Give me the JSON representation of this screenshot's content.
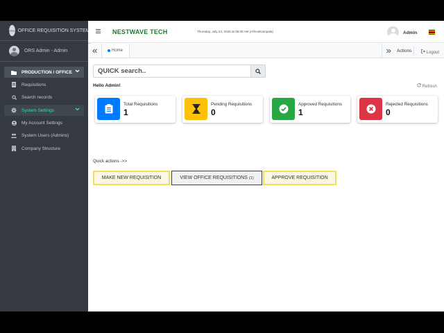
{
  "sidebar": {
    "brand_logo_text": "ORS",
    "brand_text": "OFFICE REQUISITION SYSTEM",
    "user_name": "ORS Admin - Admin",
    "items": [
      {
        "label": "PRODUCTION / OFFICE",
        "icon": "folder-icon",
        "type": "header"
      },
      {
        "label": "Requisitions",
        "icon": "document-icon",
        "type": "sub"
      },
      {
        "label": "Search records",
        "icon": "search-icon",
        "type": "sub"
      },
      {
        "label": "System Settings",
        "icon": "gear-icon",
        "type": "active"
      },
      {
        "label": "My Account Settings",
        "icon": "user-icon",
        "type": "sub"
      },
      {
        "label": "System Users (Admins)",
        "icon": "users-icon",
        "type": "sub"
      },
      {
        "label": "Company Structure",
        "icon": "building-icon",
        "type": "sub"
      }
    ]
  },
  "topbar": {
    "company": "NESTWAVE TECH",
    "datetime": "Thursday, July 23, 2026 at 06:09 AM (Africa/Kampala)",
    "user": "Admin",
    "flag_colors": [
      "#000000",
      "#fcdc04",
      "#d90000",
      "#000000",
      "#fcdc04",
      "#d90000"
    ]
  },
  "tabbar": {
    "home_label": "Home",
    "actions_label": "Actions",
    "logout_label": "Logout"
  },
  "main": {
    "search_placeholder": "QUICK search..",
    "hello": "Hello Admin!",
    "refresh_label": "Refresh",
    "stats": [
      {
        "label": "Total Requisitions",
        "value": "1",
        "color": "#007bff",
        "icon": "clipboard-icon"
      },
      {
        "label": "Pending Requisitions",
        "value": "0",
        "color": "#ffc107",
        "icon": "hourglass-icon"
      },
      {
        "label": "Approved Requisitions",
        "value": "1",
        "color": "#28a745",
        "icon": "check-circle-icon"
      },
      {
        "label": "Rejected Requisitions",
        "value": "0",
        "color": "#dc3545",
        "icon": "x-circle-icon"
      }
    ],
    "quick_label": "Quick actions ->>",
    "buttons": {
      "make": "MAKE NEW REQUISITION",
      "view": "VIEW OFFICE REQUISITIONS",
      "view_count": "(1)",
      "approve": "APPROVE REQUISITION"
    }
  }
}
